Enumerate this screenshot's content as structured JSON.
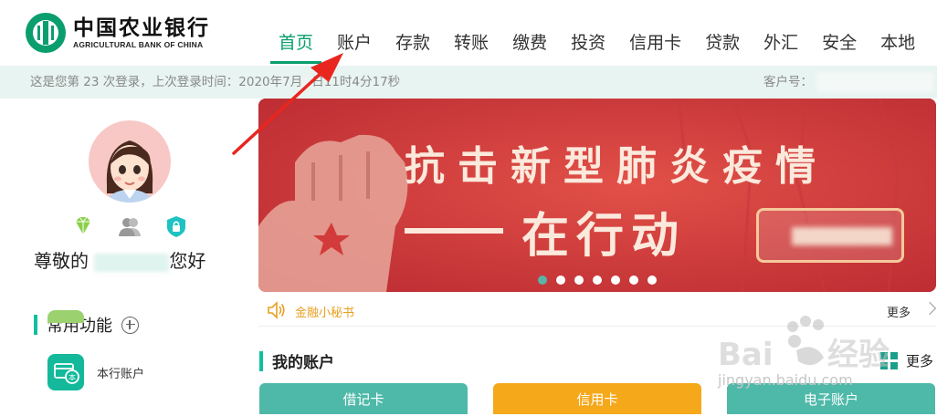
{
  "bank": {
    "name_cn": "中国农业银行",
    "name_en": "AGRICULTURAL BANK OF CHINA"
  },
  "nav": {
    "items": [
      "首页",
      "账户",
      "存款",
      "转账",
      "缴费",
      "投资",
      "信用卡",
      "贷款",
      "外汇",
      "安全",
      "本地"
    ],
    "active_index": 0
  },
  "infobar": {
    "login_info": "这是您第 23 次登录，上次登录时间：2020年7月",
    "login_info_tail": "日11时4分17秒",
    "customer_label": "客户号："
  },
  "user": {
    "greeting_prefix": "尊敬的",
    "greeting_suffix": "您好"
  },
  "common_functions": {
    "title": "常用功能",
    "items": [
      {
        "label": "本行账户",
        "icon": "card-icon",
        "color": "#13b99a"
      }
    ]
  },
  "banner": {
    "title": "抗击新型肺炎疫情",
    "subtitle": "在行动",
    "slides": 7,
    "active_slide": 0
  },
  "notice": {
    "label": "金融小秘书",
    "more": "更多"
  },
  "my_accounts": {
    "title": "我的账户",
    "more": "更多",
    "tabs": [
      "借记卡",
      "信用卡",
      "电子账户"
    ]
  },
  "watermark": {
    "text": "jingyan.baidu.com"
  },
  "colors": {
    "brand": "#0a9e6e",
    "accent": "#0fbf9f",
    "banner": "#d33a3a",
    "credit_tab": "#f6a81b",
    "debit_tab": "#4fb9a9",
    "annotation_arrow": "#e8261f"
  }
}
